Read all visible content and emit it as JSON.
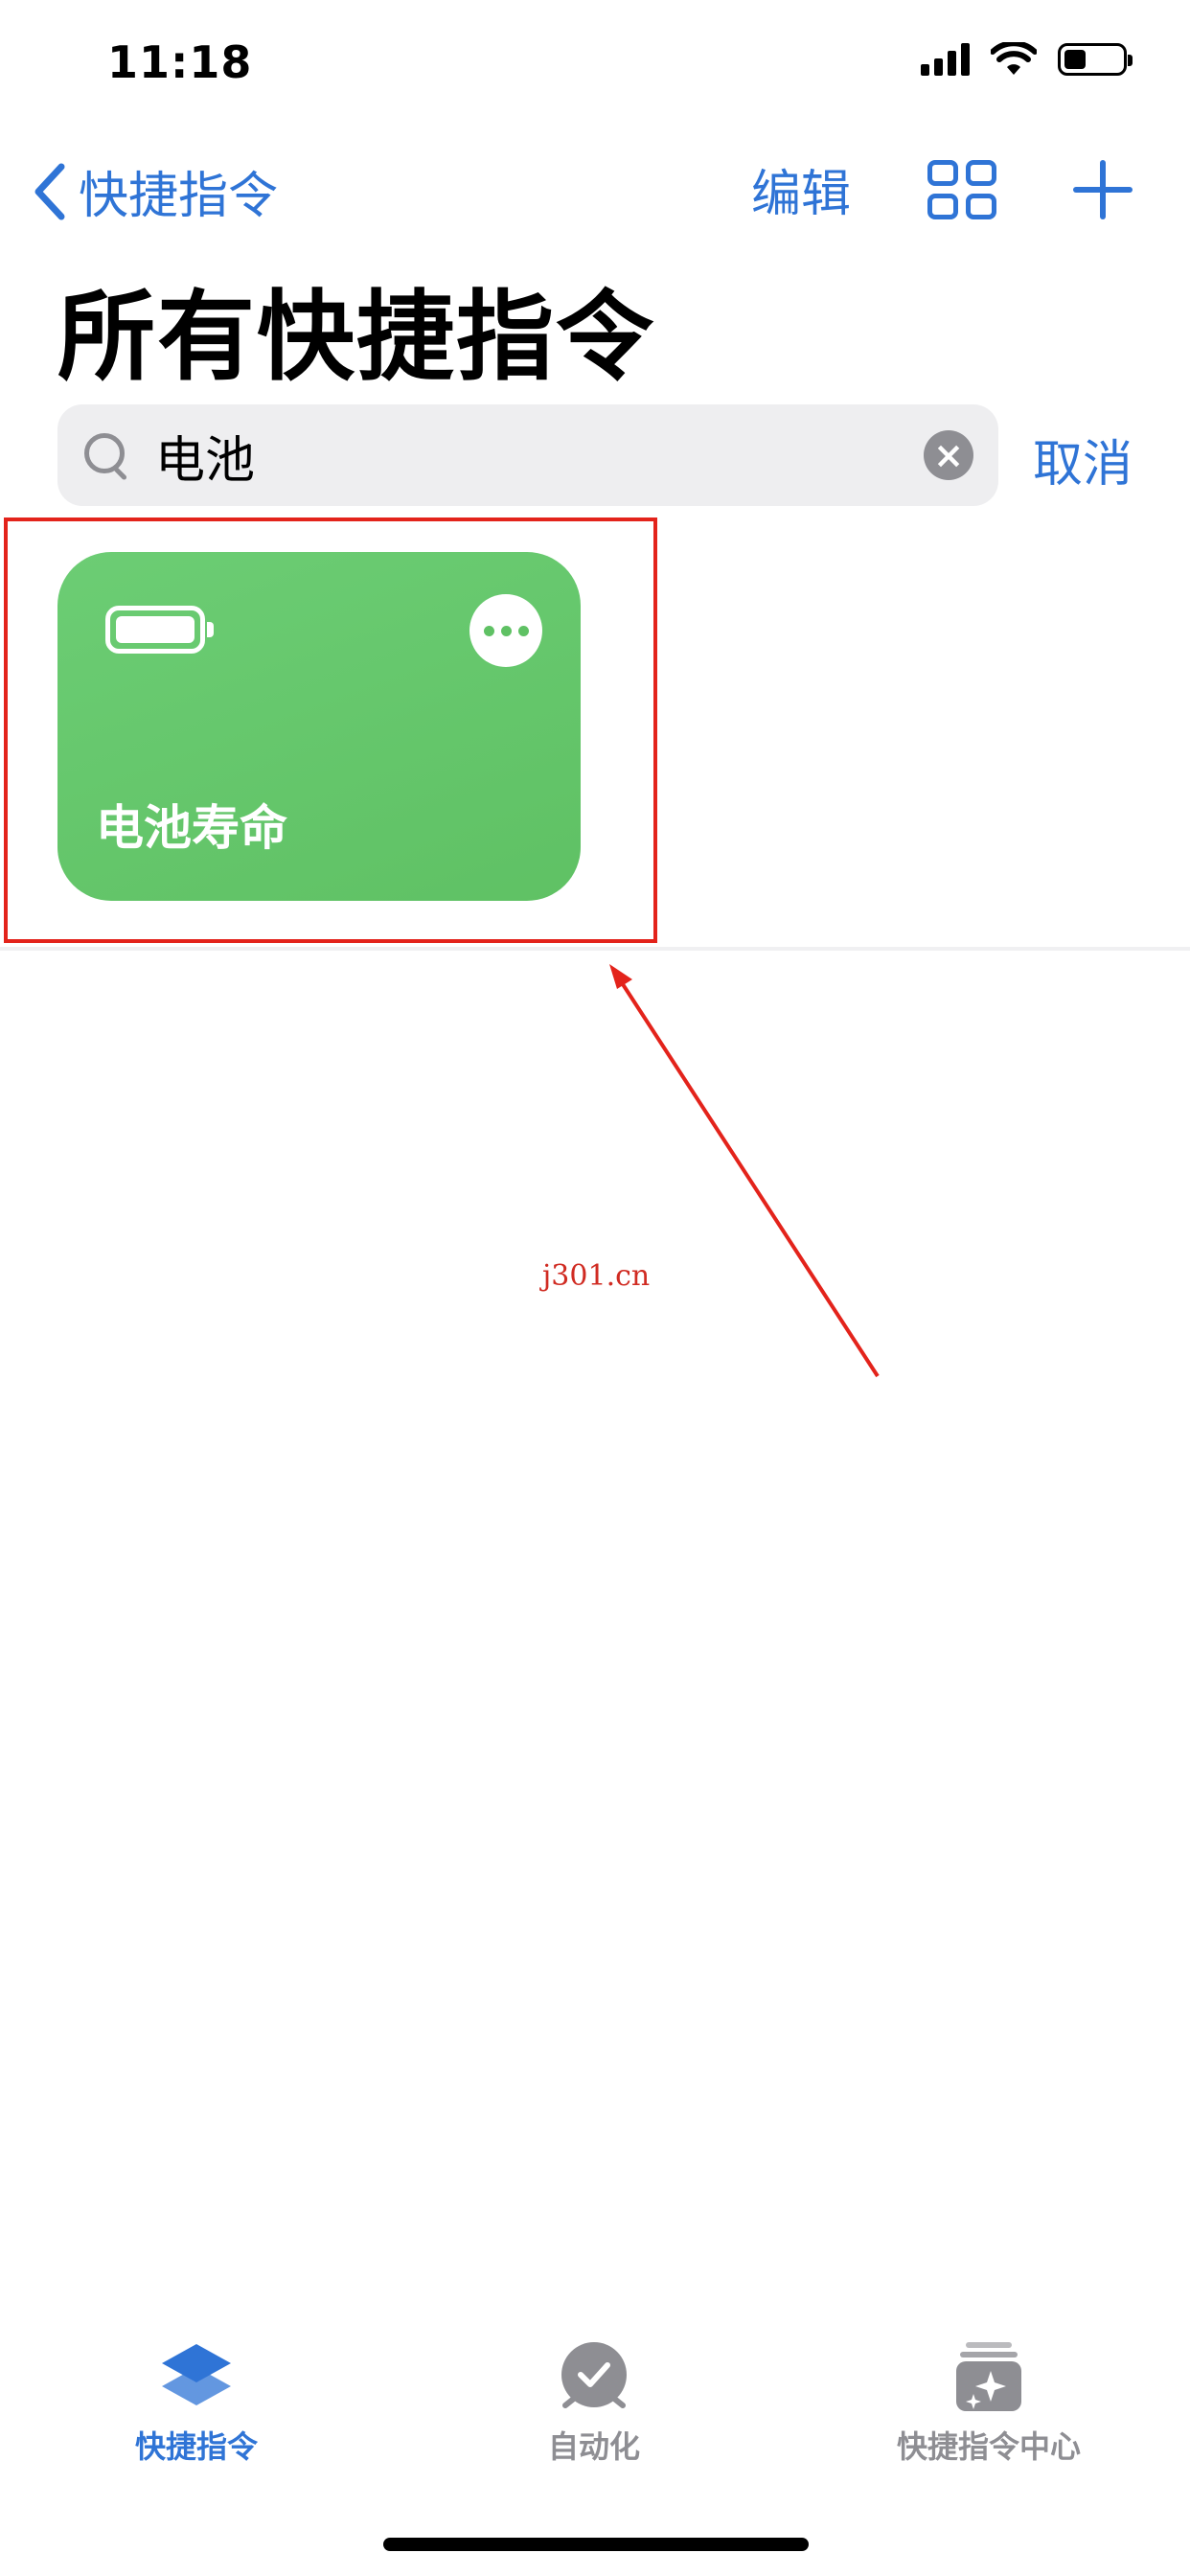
{
  "status_bar": {
    "time": "11:18"
  },
  "nav": {
    "back_label": "快捷指令",
    "edit_label": "编辑"
  },
  "page": {
    "title": "所有快捷指令"
  },
  "search": {
    "value": "电池",
    "cancel_label": "取消"
  },
  "shortcuts": [
    {
      "title": "电池寿命",
      "color": "#66c66c",
      "icon": "battery-icon"
    }
  ],
  "watermark": "j301.cn",
  "tabs": [
    {
      "label": "快捷指令",
      "icon": "stack-layers-icon",
      "active": true
    },
    {
      "label": "自动化",
      "icon": "clock-check-icon",
      "active": false
    },
    {
      "label": "快捷指令中心",
      "icon": "gallery-sparkle-icon",
      "active": false
    }
  ],
  "colors": {
    "accent": "#2f74d6",
    "highlight": "#e3231b",
    "inactive": "#8e8e93"
  }
}
